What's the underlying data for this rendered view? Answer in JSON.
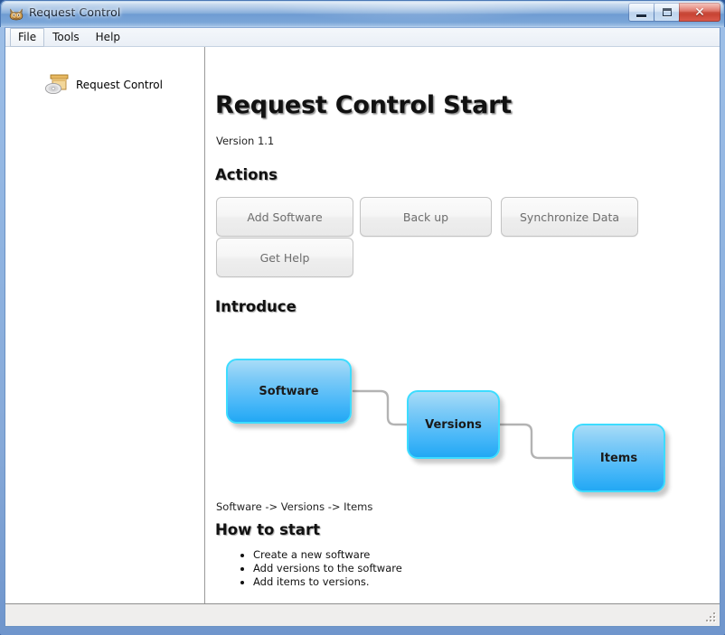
{
  "window": {
    "title": "Request Control",
    "app_icon": "cat-face-icon",
    "controls": {
      "minimize": "minimize-button",
      "maximize": "maximize-button",
      "close": "close-button"
    }
  },
  "menubar": {
    "items": [
      {
        "label": "File",
        "focused": true
      },
      {
        "label": "Tools",
        "focused": false
      },
      {
        "label": "Help",
        "focused": false
      }
    ]
  },
  "tree": {
    "nodes": [
      {
        "label": "Request Control",
        "icon": "package-disc-icon"
      }
    ]
  },
  "content": {
    "page_title": "Request Control Start",
    "version": "Version 1.1",
    "actions_heading": "Actions",
    "action_buttons": [
      {
        "label": "Add Software"
      },
      {
        "label": "Back up"
      },
      {
        "label": "Synchronize Data"
      },
      {
        "label": "Get Help"
      }
    ],
    "introduce_heading": "Introduce",
    "diagram": {
      "nodes": [
        {
          "label": "Software"
        },
        {
          "label": "Versions"
        },
        {
          "label": "Items"
        }
      ],
      "node_border_color": "#3ddcff",
      "node_fill_top": "#a8dcf7",
      "node_fill_bottom": "#22a8f4",
      "connector_color": "#b3b3b3"
    },
    "flow_text": "Software -> Versions -> Items",
    "howto_heading": "How to start",
    "howto_items": [
      "Create a new software",
      "Add versions to the software",
      "Add items to versions."
    ]
  },
  "statusbar": {
    "text": "",
    "grip": "resize-grip-icon"
  }
}
